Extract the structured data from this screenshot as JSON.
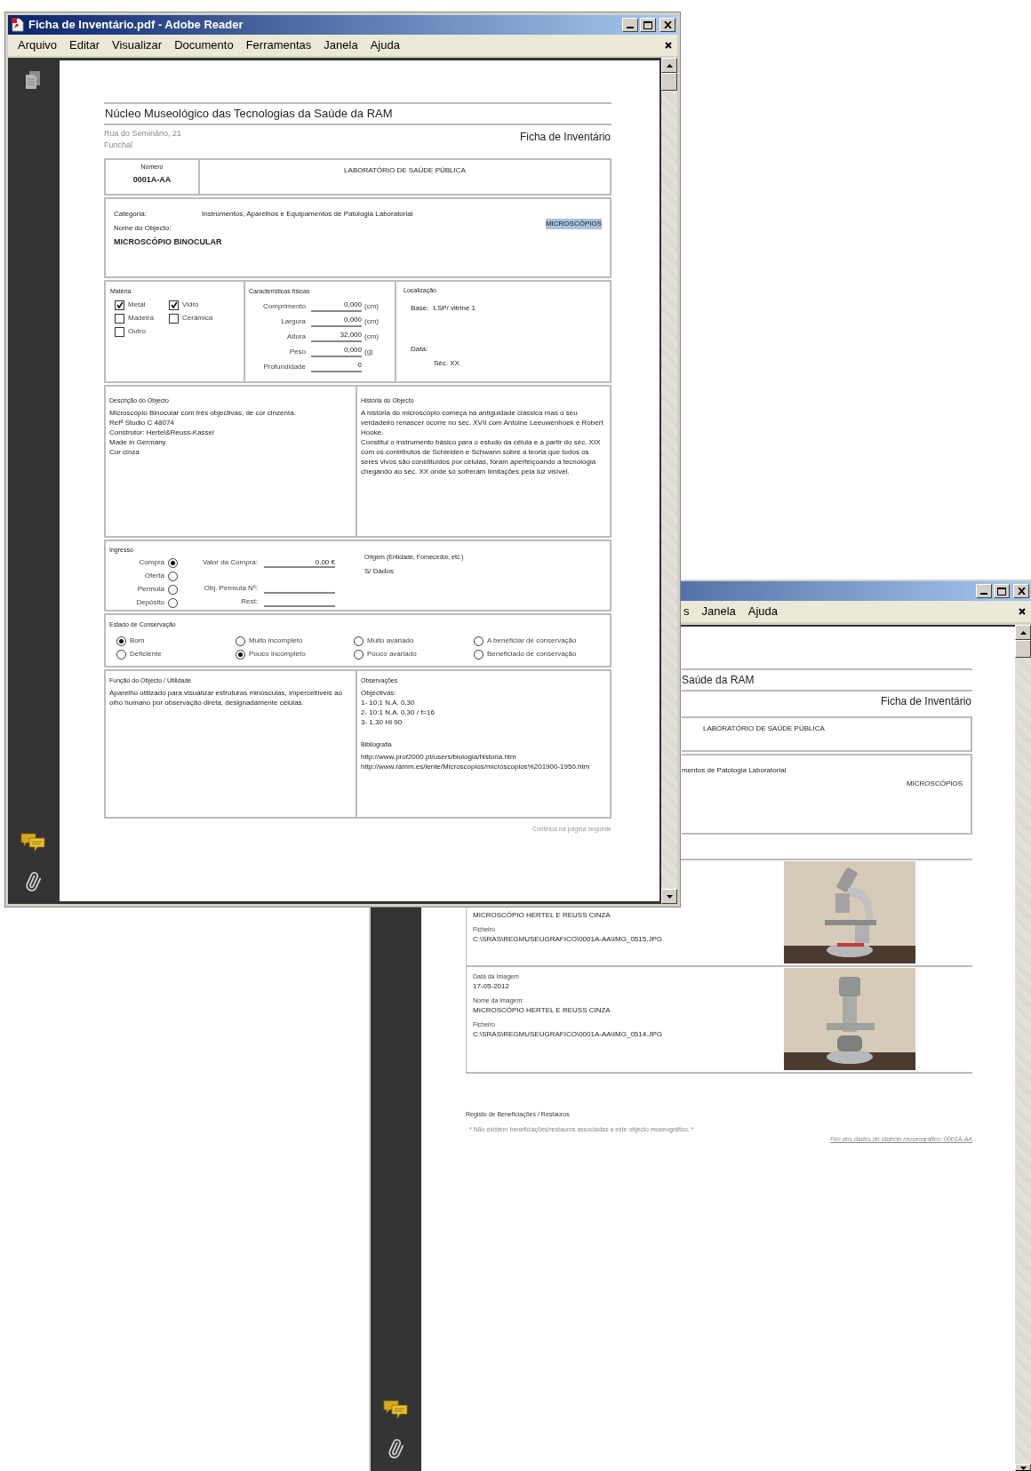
{
  "front_window": {
    "title": "Ficha de Inventário.pdf - Adobe Reader",
    "menu": [
      "Arquivo",
      "Editar",
      "Visualizar",
      "Documento",
      "Ferramentas",
      "Janela",
      "Ajuda"
    ],
    "document": {
      "title": "Núcleo Museológico das Tecnologias da Saúde da RAM",
      "address_lines": [
        "Rua do Seminário, 21",
        "Funchal"
      ],
      "form_title": "Ficha de Inventário",
      "number_label": "Número",
      "number_value": "0001A-AA",
      "department": "LABORATÓRIO DE SAÚDE PÚBLICA",
      "category_label": "Categoria:",
      "category_value": "Instrumentos, Aparelhos e Equipamentos de Patologia Laboratorial",
      "name_label": "Nome do Objecto:",
      "name_value": "MICROSCÓPIO BINOCULAR",
      "group": {
        "text": "MICROSCÓPIOS",
        "highlighted": true
      },
      "material": {
        "label": "Matéria",
        "items": [
          {
            "label": "Metal",
            "checked": true
          },
          {
            "label": "Vidro",
            "checked": true
          },
          {
            "label": "Madeira",
            "checked": false
          },
          {
            "label": "Cerâmica",
            "checked": false
          },
          {
            "label": "Outro",
            "checked": false
          }
        ]
      },
      "physical": {
        "label": "Características físicas",
        "rows": [
          {
            "label": "Comprimento",
            "value": "0,000",
            "unit": "(cm)"
          },
          {
            "label": "Largura",
            "value": "0,000",
            "unit": "(cm)"
          },
          {
            "label": "Altura",
            "value": "32,000",
            "unit": "(cm)"
          },
          {
            "label": "Peso",
            "value": "0,000",
            "unit": "(g)"
          },
          {
            "label": "Profundidade",
            "value": "0"
          }
        ]
      },
      "location": {
        "label": "Localização",
        "base_label": "Base:",
        "base_value": "LSP/ vitrine 1",
        "date_label": "Data:",
        "date_value": "Séc. XX"
      },
      "description": {
        "label": "Descrição do Objecto",
        "lines": [
          "Microscópio Binocular com três objectivas, de cor cinzenta.",
          "Refª Studio C 48074",
          "Construtor: Hertel&Reuss-Kassel",
          "Made in Germany",
          "Cor cinza"
        ]
      },
      "history": {
        "label": "História do Objecto",
        "paragraphs": [
          "A história do microscópio começa na antiguidade clássica mas o seu verdadeiro renascer ocorre no séc. XVII com Antoine Leeuwenhoek e Robert Hooke.",
          "Constitui o instrumento básico para o estudo da célula e a partir do séc. XIX com os contributos de Schleiden e Schwann sobre a teoria que todos os seres vivos são constituídos por células, foram aperfeiçoando a tecnologia chegando ao séc. XX onde só sofreram limitações pela luz visível."
        ]
      },
      "acquisition": {
        "label": "Ingresso",
        "options": [
          {
            "label": "Compra",
            "selected": true
          },
          {
            "label": "Oferta",
            "selected": false
          },
          {
            "label": "Permuta",
            "selected": false
          },
          {
            "label": "Depósito",
            "selected": false
          }
        ],
        "fields": [
          {
            "label": "Valor da Compra:",
            "value": "0,00 €"
          },
          {
            "label": "Obj. Permuta Nº:"
          },
          {
            "label": "Rest:"
          }
        ],
        "origin_label": "Origem (Entidade, Fornecedor, etc.)",
        "origin_value": "S/ Dados"
      },
      "conservation": {
        "label": "Estado de Conservação",
        "options": [
          {
            "label": "Bom",
            "selected": true
          },
          {
            "label": "Deficiente",
            "selected": false
          },
          {
            "label": "Muito incompleto",
            "selected": false
          },
          {
            "label": "Pouco incompleto",
            "selected": true
          },
          {
            "label": "Muito avariado",
            "selected": false
          },
          {
            "label": "Pouco avariado",
            "selected": false
          },
          {
            "label": "A beneficiar de conservação",
            "selected": false
          },
          {
            "label": "Beneficiado de conservação",
            "selected": false
          }
        ]
      },
      "function": {
        "label": "Função do Objecto / Utilidade",
        "text": "Aparelho utilizado para visualizar estruturas minúsculas, imperceitíveis ao olho humano por observação direta, designadamente células."
      },
      "observations": {
        "label": "Observações",
        "lines": [
          "Objectivas:",
          "1- 10:1 N.A. 0,30",
          "2- 10:1 N.A. 0,30 / f=16",
          "3- 1,30 HI 90"
        ]
      },
      "bibliography": {
        "label": "Bibliografia",
        "links": [
          "http://www.prof2000.pt/users/biologia/historia.htm",
          "http://www.ramm.es/lente/Microscopios/microscopios%201900-1950.htm"
        ]
      },
      "continued": "Continua na página seguinte"
    }
  },
  "back_window": {
    "menu": [
      "s",
      "Janela",
      "Ajuda"
    ],
    "document": {
      "title_fragment": "Saúde da RAM",
      "form_title": "Ficha de Inventário",
      "department": "LABORATÓRIO DE SAÚDE PÚBLICA",
      "category_fragment": "mentos de Patologia Laboratorial",
      "group": "MICROSCÓPIOS",
      "images": [
        {
          "lines": [
            {
              "kind": "value",
              "text": "MICROSCÓPIO  HERTEL E REUSS CINZA"
            },
            {
              "kind": "label",
              "text": "Ficheiro"
            },
            {
              "kind": "value",
              "text": "C:\\SRAS\\REGMUSEUGRAFICO\\0001A-AA\\IMG_0515.JPG"
            }
          ],
          "picture": {
            "kind": "picture"
          }
        },
        {
          "lines": [
            {
              "kind": "label",
              "text": "Data da Imagem"
            },
            {
              "kind": "value",
              "text": "17-05-2012"
            },
            {
              "kind": "label",
              "text": "Nome da imagem:"
            },
            {
              "kind": "value",
              "text": "MICROSCÓPIO HERTEL E REUSS CINZA"
            },
            {
              "kind": "label",
              "text": "Ficheiro"
            },
            {
              "kind": "value",
              "text": "C:\\SRAS\\REGMUSEUGRAFICO\\0001A-AA\\IMG_0514.JPG"
            }
          ],
          "picture": {
            "kind": "picture"
          }
        }
      ],
      "restorations_label": "Registo de Beneficiações / Restauros",
      "restorations_note": "* Não existem beneficiações/restauros associadas a este objecto museográfico. *",
      "end_note": "Fim dos dados do objecto museográfico: 0001A-AA"
    }
  }
}
